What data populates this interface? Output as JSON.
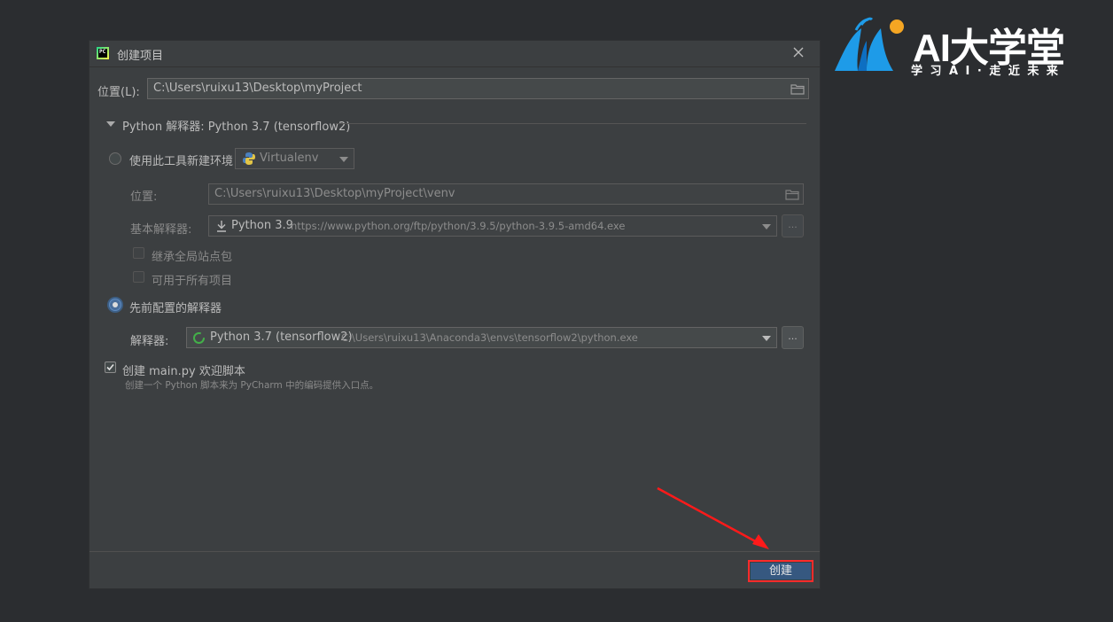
{
  "dialog": {
    "title": "创建项目",
    "location_label": "位置(L):",
    "location_value": "C:\\Users\\ruixu13\\Desktop\\myProject",
    "interpreter_section": "Python 解释器: Python 3.7 (tensorflow2)",
    "new_env": {
      "radio_label": "使用此工具新建环境",
      "tool": "Virtualenv",
      "location_label": "位置:",
      "location_value": "C:\\Users\\ruixu13\\Desktop\\myProject\\venv",
      "base_label": "基本解释器:",
      "base_name": "Python 3.9",
      "base_url": "https://www.python.org/ftp/python/3.9.5/python-3.9.5-amd64.exe",
      "inherit_label": "继承全局站点包",
      "all_projects_label": "可用于所有项目",
      "ellipsis": "..."
    },
    "existing": {
      "radio_label": "先前配置的解释器",
      "interpreter_label": "解释器:",
      "interpreter_name": "Python 3.7 (tensorflow2)",
      "interpreter_path": "C:\\Users\\ruixu13\\Anaconda3\\envs\\tensorflow2\\python.exe",
      "ellipsis": "..."
    },
    "main_py": {
      "checkbox_label": "创建 main.py 欢迎脚本",
      "hint": "创建一个 Python 脚本来为 PyCharm 中的编码提供入口点。",
      "checked": true
    },
    "create_button": "创建"
  },
  "app_icon_text": "PC",
  "logo": {
    "title": "AI大学堂",
    "subtitle": "学习AI·走近未来"
  },
  "colors": {
    "background": "#2b2d30",
    "dialog": "#3c3f41",
    "accent_button": "#365880",
    "highlight": "#ff2b2b",
    "logo_blue": "#1e9be8",
    "logo_orange": "#f5a623"
  }
}
